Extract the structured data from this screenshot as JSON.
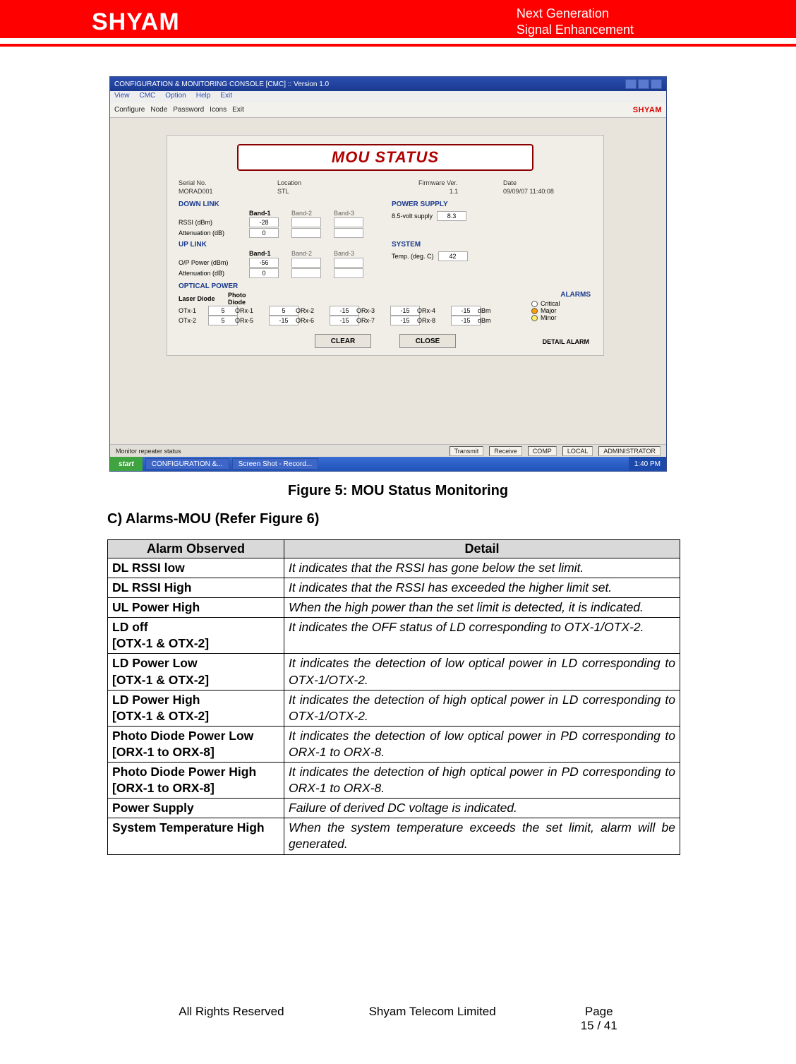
{
  "header": {
    "logo": "SHYAM",
    "right_line1": "Next Generation",
    "right_line2": "Signal Enhancement"
  },
  "screenshot": {
    "window_title": "CONFIGURATION & MONITORING CONSOLE [CMC] :: Version 1.0",
    "menus": [
      "View",
      "CMC",
      "Option",
      "Help",
      "Exit"
    ],
    "toolbar": {
      "configure": "Configure",
      "node": "Node",
      "password": "Password",
      "icons": "Icons",
      "exit": "Exit",
      "brand": "SHYAM"
    },
    "banner": "MOU STATUS",
    "top_fields": {
      "serial_lbl": "Serial No.",
      "serial_val": "MORAD001",
      "location_lbl": "Location",
      "location_val": "STL",
      "firmware_lbl": "Firmware Ver.",
      "firmware_val": "1.1",
      "date_lbl": "Date",
      "date_val": "09/09/07 11:40:08"
    },
    "downlink": {
      "title": "DOWN LINK",
      "band1": "Band-1",
      "band2": "Band-2",
      "band3": "Band-3",
      "rssi_lbl": "RSSI (dBm)",
      "rssi_b1": "-28",
      "att_lbl": "Attenuation (dB)",
      "att_b1": "0"
    },
    "uplink": {
      "title": "UP LINK",
      "band1": "Band-1",
      "band2": "Band-2",
      "band3": "Band-3",
      "op_lbl": "O/P Power (dBm)",
      "op_b1": "-56",
      "att_lbl": "Attenuation (dB)",
      "att_b1": "0"
    },
    "powersupply": {
      "title": "POWER SUPPLY",
      "lbl": "8.5-volt supply",
      "val": "8.3"
    },
    "system": {
      "title": "SYSTEM",
      "lbl": "Temp. (deg. C)",
      "val": "42"
    },
    "optical": {
      "title": "OPTICAL POWER",
      "laser_diode": "Laser Diode",
      "photo_diode": "Photo Diode",
      "otx1_lbl": "OTx-1",
      "otx1_val": "5",
      "otx2_lbl": "OTx-2",
      "otx2_val": "5",
      "orx1_lbl": "ORx-1",
      "orx1_val": "5",
      "orx5_lbl": "ORx-5",
      "orx5_val": "-15",
      "orx2_lbl": "ORx-2",
      "orx2_val": "-15",
      "orx6_lbl": "ORx-6",
      "orx6_val": "-15",
      "orx3_lbl": "ORx-3",
      "orx3_val": "-15",
      "orx7_lbl": "ORx-7",
      "orx7_val": "-15",
      "orx4_lbl": "ORx-4",
      "orx4_val": "-15",
      "orx8_lbl": "ORx-8",
      "orx8_val": "-15",
      "unit": "dBm"
    },
    "alarms": {
      "title": "ALARMS",
      "critical": "Critical",
      "major": "Major",
      "minor": "Minor"
    },
    "buttons": {
      "clear": "CLEAR",
      "close": "CLOSE",
      "detail": "DETAIL ALARM"
    },
    "statusbar": {
      "msg": "Monitor repeater status",
      "transmit": "Transmit",
      "receive": "Receive",
      "comp": "COMP",
      "local": "LOCAL",
      "admin": "ADMINISTRATOR"
    },
    "taskbar": {
      "start": "start",
      "item1": "CONFIGURATION &...",
      "item2": "Screen Shot - Record...",
      "clock": "1:40 PM"
    }
  },
  "figure_caption": "Figure 5: MOU Status Monitoring",
  "section_heading": "C) Alarms-MOU (Refer Figure 6)",
  "alarm_table": {
    "headers": {
      "alarm": "Alarm Observed",
      "detail": "Detail"
    },
    "rows": [
      {
        "alarm": "DL RSSI low",
        "detail": "It indicates that the RSSI has gone below the set limit."
      },
      {
        "alarm": "DL RSSI High",
        "detail": "It indicates that the RSSI has exceeded the higher limit set."
      },
      {
        "alarm": "UL Power High",
        "detail": " When the high power than the set limit is detected, it is indicated."
      },
      {
        "alarm": "LD off",
        "sub": "[OTX-1 & OTX-2]",
        "detail": "It indicates the OFF status of LD corresponding to OTX-1/OTX-2."
      },
      {
        "alarm": "LD Power Low",
        "sub": " [OTX-1 & OTX-2]",
        "detail": "It indicates the detection of low optical power in LD corresponding to OTX-1/OTX-2."
      },
      {
        "alarm": "LD Power High",
        "sub": " [OTX-1 & OTX-2]",
        "detail": "It indicates the detection of high optical power in LD corresponding to OTX-1/OTX-2."
      },
      {
        "alarm": "Photo Diode Power Low",
        "sub": "[ORX-1 to ORX-8]",
        "detail": " It indicates the detection of low optical power in PD corresponding to ORX-1 to ORX-8."
      },
      {
        "alarm": "Photo Diode Power High",
        "sub": "[ORX-1 to ORX-8]",
        "detail": " It indicates the detection of high optical power in PD corresponding to ORX-1 to ORX-8."
      },
      {
        "alarm": "Power Supply",
        "detail": " Failure of derived DC voltage is indicated."
      },
      {
        "alarm": "System Temperature High",
        "detail": "When the system temperature exceeds the set limit, alarm will be generated."
      }
    ]
  },
  "footer": {
    "left": "All Rights Reserved",
    "center": "Shyam Telecom Limited",
    "right_label": "Page",
    "right_num": "15 / 41"
  }
}
